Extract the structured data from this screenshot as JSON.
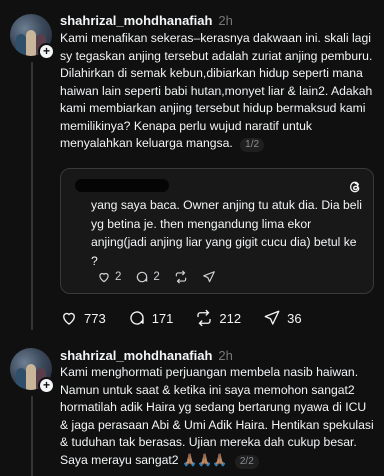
{
  "posts": [
    {
      "username": "shahrizal_mohdhanafiah",
      "time": "2h",
      "paragraph1": "Kami menafikan sekeras–kerasnya dakwaan ini. skali lagi sy tegaskan anjing tersebut adalah zuriat anjing pemburu.",
      "paragraph2": "Dilahirkan di semak kebun,dibiarkan hidup seperti mana haiwan lain seperti babi hutan,monyet liar & lain2. Adakah kami membiarkan anjing tersebut hidup bermaksud kami memilikinya? Kenapa perlu wujud naratif untuk menyalahkan keluarga mangsa.",
      "counter": "1/2",
      "quote": {
        "text": "yang saya baca. Owner anjing tu atuk dia. Dia beli yg betina je. then mengandung lima ekor anjing(jadi anjing liar yang gigit cucu dia) betul ke ?",
        "likes": "2",
        "replies": "2"
      },
      "stats": {
        "likes": "773",
        "replies": "171",
        "reposts": "212",
        "shares": "36"
      }
    },
    {
      "username": "shahrizal_mohdhanafiah",
      "time": "2h",
      "paragraph1": "Kami menghormati perjuangan membela nasib haiwan. Namun untuk saat & ketika ini saya memohon sangat2 hormatilah adik Haira yg sedang bertarung nyawa di ICU & jaga perasaan Abi & Umi Adik Haira. Hentikan spekulasi & tuduhan tak berasas. Ujian mereka dah cukup besar. Saya merayu sangat2 🙏🏽🙏🏽🙏🏽",
      "counter": "2/2"
    }
  ],
  "colors": {
    "background": "#101010",
    "text": "#f3f5f7",
    "muted": "#777777",
    "border": "#393939"
  }
}
